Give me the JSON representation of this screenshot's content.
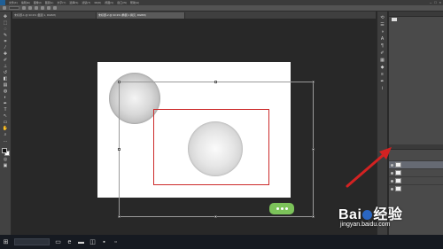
{
  "menubar": {
    "items": [
      "文件(F)",
      "编辑(E)",
      "图像(I)",
      "图层(L)",
      "文字(Y)",
      "选择(S)",
      "滤镜(T)",
      "3D(D)",
      "视图(V)",
      "窗口(W)",
      "帮助(H)"
    ]
  },
  "tabs": [
    {
      "label": "未标题-1 @ 33.3% (图层 1, RGB/8)"
    },
    {
      "label": "未标题-2 @ 33.3% (椭圆 1 拷贝, RGB/8)"
    }
  ],
  "watermark": {
    "brand_prefix": "Bai",
    "brand_suffix": "经验",
    "url": "jingyan.baidu.com"
  },
  "colors": {
    "selection_outline": "#cc2b2b",
    "arrow": "#d32222",
    "badge": "#7cc35a"
  }
}
